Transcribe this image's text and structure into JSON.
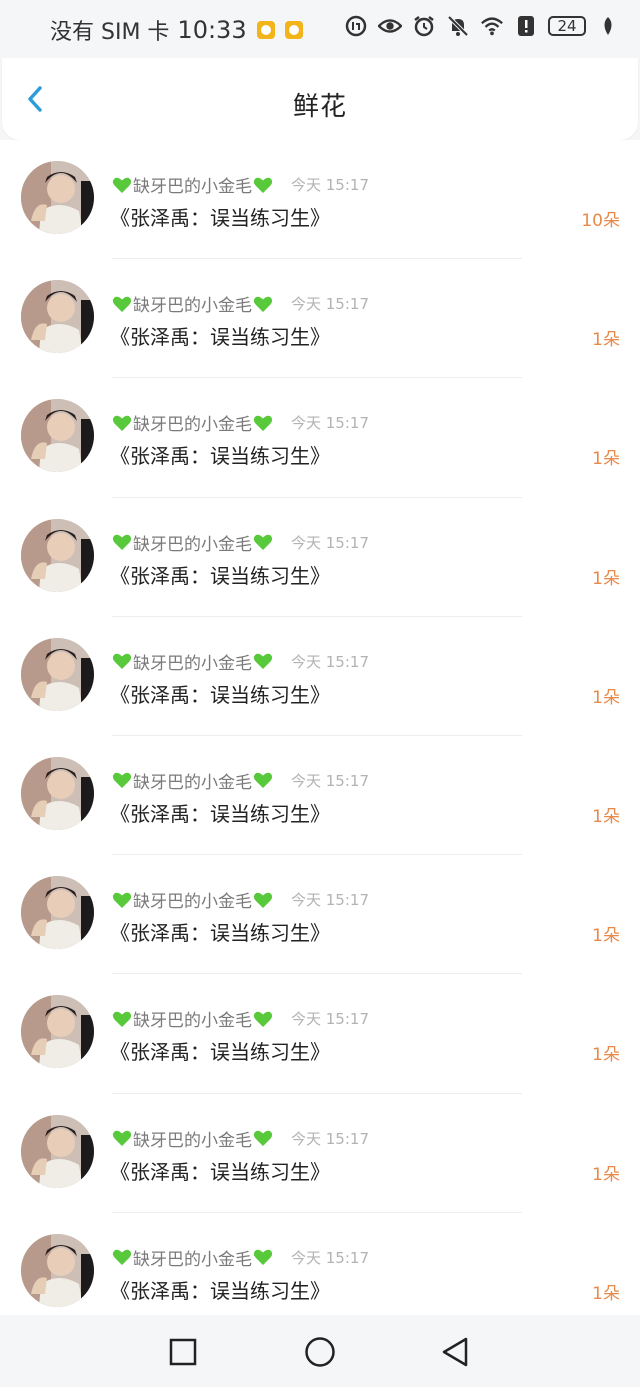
{
  "status_bar": {
    "carrier": "没有 SIM 卡",
    "time": "10:33",
    "battery": "24",
    "icons": [
      "notification-app-icon",
      "notification-app-icon",
      "data-saver-icon",
      "eye-comfort-icon",
      "alarm-icon",
      "mute-icon",
      "wifi-icon",
      "alert-icon",
      "battery-icon",
      "leaf-icon"
    ]
  },
  "header": {
    "title": "鲜花",
    "back_icon": "chevron-left-icon",
    "accent_color": "#2d9cdb"
  },
  "list": {
    "items": [
      {
        "name": "缺牙巴的小金毛",
        "time": "今天 15:17",
        "gift": "《张泽禹：误当练习生》",
        "count": "10朵"
      },
      {
        "name": "缺牙巴的小金毛",
        "time": "今天 15:17",
        "gift": "《张泽禹：误当练习生》",
        "count": "1朵"
      },
      {
        "name": "缺牙巴的小金毛",
        "time": "今天 15:17",
        "gift": "《张泽禹：误当练习生》",
        "count": "1朵"
      },
      {
        "name": "缺牙巴的小金毛",
        "time": "今天 15:17",
        "gift": "《张泽禹：误当练习生》",
        "count": "1朵"
      },
      {
        "name": "缺牙巴的小金毛",
        "time": "今天 15:17",
        "gift": "《张泽禹：误当练习生》",
        "count": "1朵"
      },
      {
        "name": "缺牙巴的小金毛",
        "time": "今天 15:17",
        "gift": "《张泽禹：误当练习生》",
        "count": "1朵"
      },
      {
        "name": "缺牙巴的小金毛",
        "time": "今天 15:17",
        "gift": "《张泽禹：误当练习生》",
        "count": "1朵"
      },
      {
        "name": "缺牙巴的小金毛",
        "time": "今天 15:17",
        "gift": "《张泽禹：误当练习生》",
        "count": "1朵"
      },
      {
        "name": "缺牙巴的小金毛",
        "time": "今天 15:17",
        "gift": "《张泽禹：误当练习生》",
        "count": "1朵"
      },
      {
        "name": "缺牙巴的小金毛",
        "time": "今天 15:17",
        "gift": "《张泽禹：误当练习生》",
        "count": "1朵"
      }
    ],
    "count_color": "#e8894a",
    "heart_color": "#57c93a"
  },
  "nav_bar": {
    "icons": [
      "recent-apps-icon",
      "home-icon",
      "back-icon"
    ]
  }
}
